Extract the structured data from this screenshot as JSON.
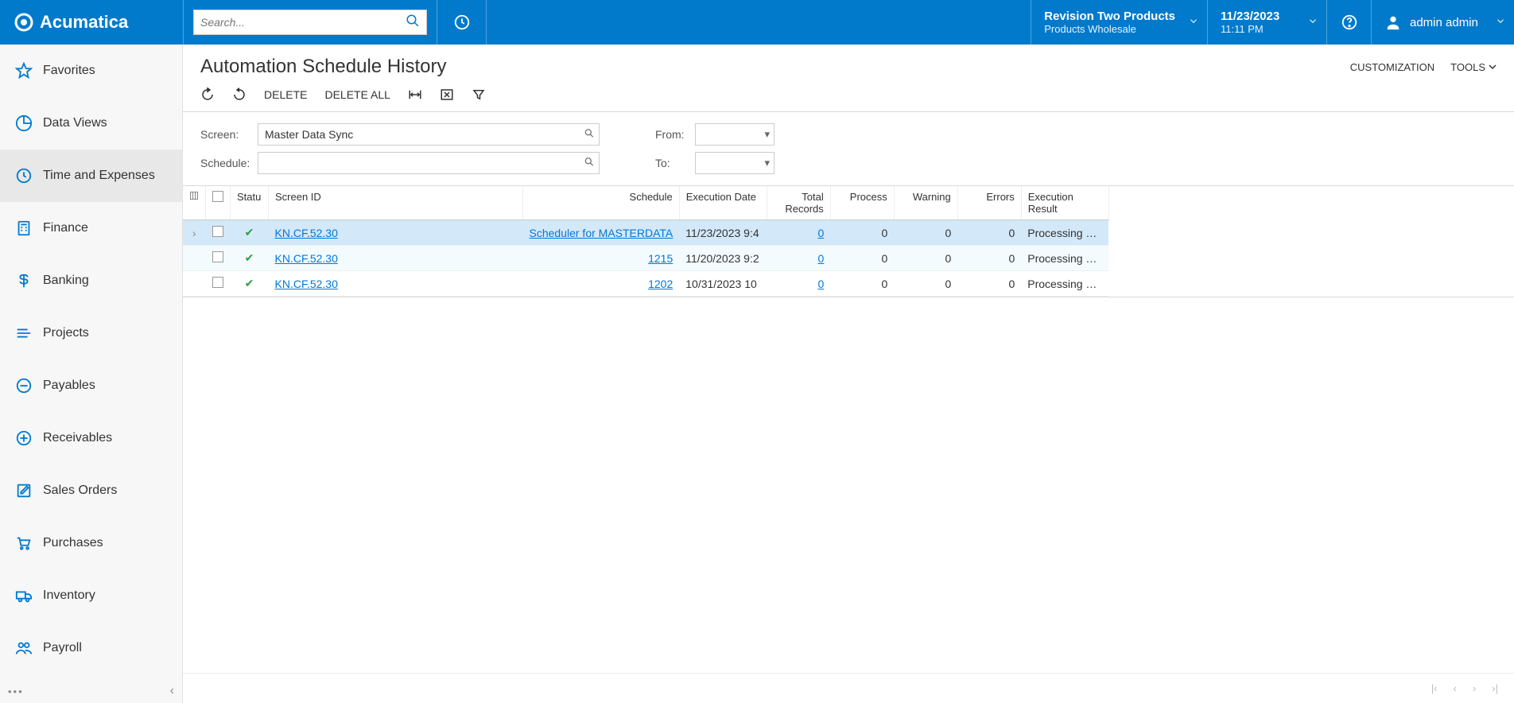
{
  "brand": "Acumatica",
  "search": {
    "placeholder": "Search..."
  },
  "tenant": {
    "name": "Revision Two Products",
    "sub": "Products Wholesale"
  },
  "datetime": {
    "date": "11/23/2023",
    "time": "11:11 PM"
  },
  "user": {
    "name": "admin admin"
  },
  "nav": [
    {
      "key": "favorites",
      "label": "Favorites",
      "icon": "star"
    },
    {
      "key": "data-views",
      "label": "Data Views",
      "icon": "pie"
    },
    {
      "key": "time-expenses",
      "label": "Time and Expenses",
      "icon": "clock",
      "active": true
    },
    {
      "key": "finance",
      "label": "Finance",
      "icon": "calc"
    },
    {
      "key": "banking",
      "label": "Banking",
      "icon": "dollar"
    },
    {
      "key": "projects",
      "label": "Projects",
      "icon": "layers"
    },
    {
      "key": "payables",
      "label": "Payables",
      "icon": "minus"
    },
    {
      "key": "receivables",
      "label": "Receivables",
      "icon": "plus"
    },
    {
      "key": "sales-orders",
      "label": "Sales Orders",
      "icon": "edit"
    },
    {
      "key": "purchases",
      "label": "Purchases",
      "icon": "cart"
    },
    {
      "key": "inventory",
      "label": "Inventory",
      "icon": "truck"
    },
    {
      "key": "payroll",
      "label": "Payroll",
      "icon": "people"
    }
  ],
  "page": {
    "title": "Automation Schedule History",
    "actions": {
      "customization": "CUSTOMIZATION",
      "tools": "TOOLS"
    }
  },
  "toolbar": {
    "delete": "DELETE",
    "delete_all": "DELETE ALL"
  },
  "filters": {
    "screen_label": "Screen:",
    "screen_value": "Master Data Sync",
    "schedule_label": "Schedule:",
    "schedule_value": "",
    "from_label": "From:",
    "from_value": "",
    "to_label": "To:",
    "to_value": ""
  },
  "grid": {
    "columns": {
      "status": "Statu",
      "screen_id": "Screen ID",
      "schedule": "Schedule",
      "exec_date": "Execution Date",
      "total_records": "Total Records",
      "process": "Process",
      "warning": "Warning",
      "errors": "Errors",
      "exec_result": "Execution Result"
    },
    "rows": [
      {
        "screen_id": "KN.CF.52.30",
        "schedule": "Scheduler for MASTERDATA",
        "exec_date": "11/23/2023 9:4",
        "total_records": "0",
        "process": "0",
        "warning": "0",
        "errors": "0",
        "result": "Processing …",
        "selected": true
      },
      {
        "screen_id": "KN.CF.52.30",
        "schedule": "1215",
        "exec_date": "11/20/2023 9:2",
        "total_records": "0",
        "process": "0",
        "warning": "0",
        "errors": "0",
        "result": "Processing …"
      },
      {
        "screen_id": "KN.CF.52.30",
        "schedule": "1202",
        "exec_date": "10/31/2023 10",
        "total_records": "0",
        "process": "0",
        "warning": "0",
        "errors": "0",
        "result": "Processing …"
      }
    ]
  }
}
